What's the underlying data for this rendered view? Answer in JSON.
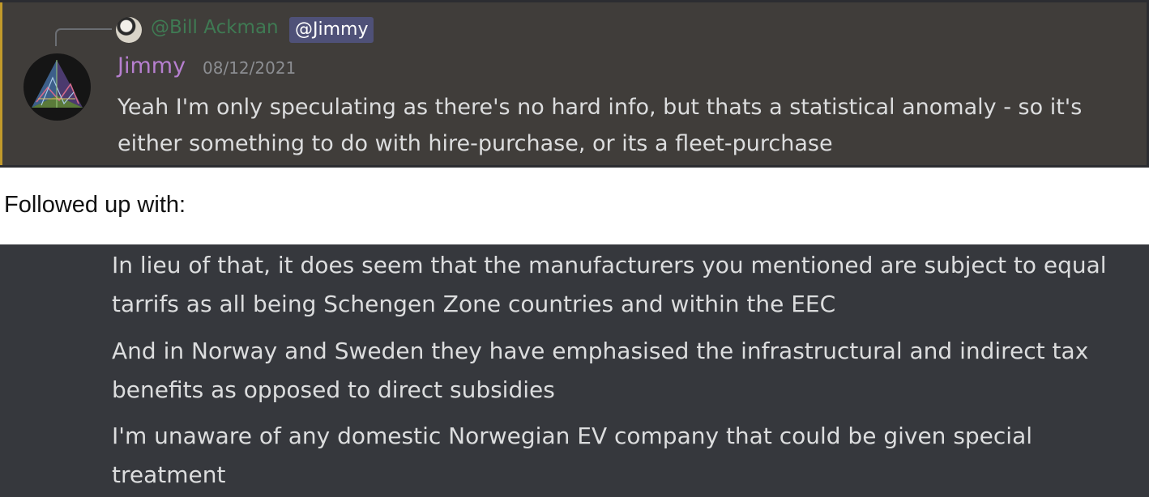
{
  "reply_preview": {
    "username": "@Bill Ackman",
    "mention": "@Jimmy"
  },
  "message": {
    "author": "Jimmy",
    "timestamp": "08/12/2021",
    "text": "Yeah I'm only speculating as there's no hard info, but thats a statistical anomaly - so it's either something to do with hire-purchase, or its a fleet-purchase"
  },
  "intro": "Followed up with:",
  "followups": [
    "In lieu of that, it does seem that the manufacturers you mentioned are subject to equal tarrifs as all being Schengen Zone countries and within the EEC",
    "And in Norway and Sweden they have emphasised the infrastructural and indirect tax benefits as opposed to direct subsidies",
    "I'm unaware of any domestic Norwegian EV company that could be given special treatment"
  ],
  "colors": {
    "mention_highlight": "#403d3a",
    "mention_accent": "#c29a2b",
    "author_name": "#b67fcf",
    "reply_username": "#3f7a53",
    "mention_pill": "#4f5178",
    "followup_background": "#36383d"
  }
}
